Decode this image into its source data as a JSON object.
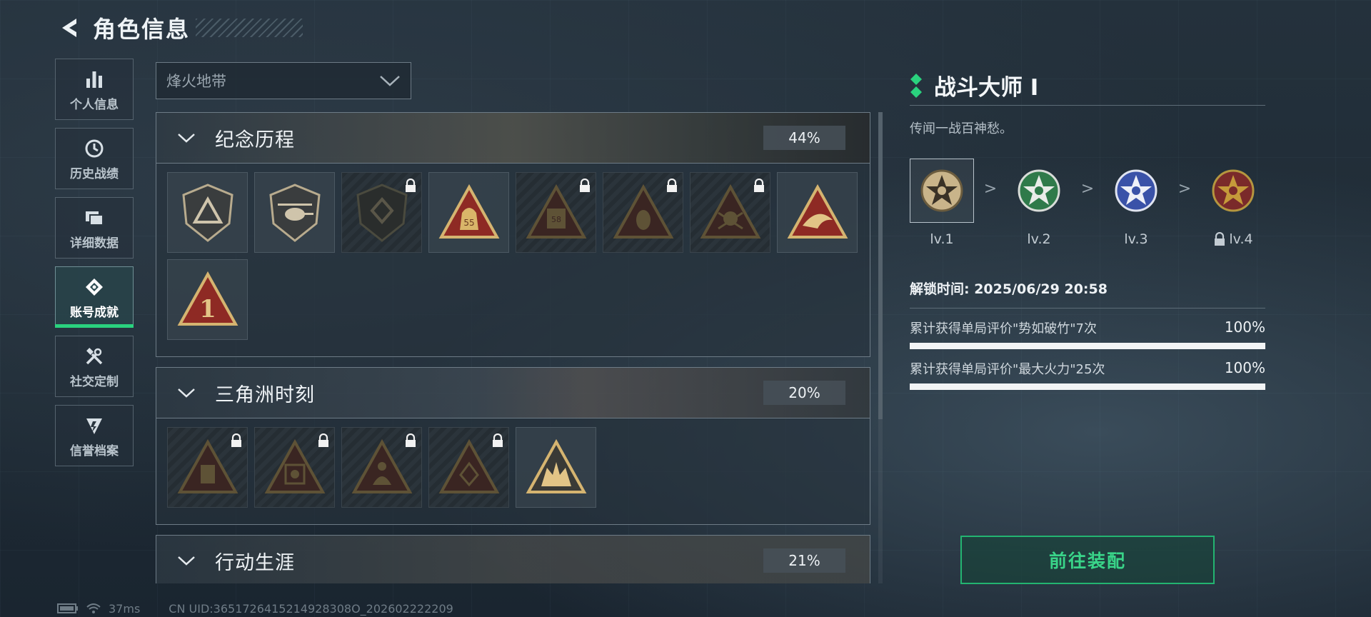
{
  "header": {
    "title": "角色信息"
  },
  "sidebar": {
    "items": [
      {
        "label": "个人信息",
        "icon": "bar-chart-icon"
      },
      {
        "label": "历史战绩",
        "icon": "history-clock-icon"
      },
      {
        "label": "详细数据",
        "icon": "folders-icon"
      },
      {
        "label": "账号成就",
        "icon": "achievement-icon",
        "active": true
      },
      {
        "label": "社交定制",
        "icon": "tools-icon"
      },
      {
        "label": "信誉档案",
        "icon": "reputation-icon"
      }
    ]
  },
  "dropdown": {
    "value": "烽火地带"
  },
  "sections": [
    {
      "name": "纪念历程",
      "percent": "44%",
      "badges_locked": [
        false,
        false,
        true,
        false,
        true,
        true,
        true,
        false,
        false
      ],
      "badge_text": {
        "3": "55",
        "4": "58",
        "8": "1"
      }
    },
    {
      "name": "三角洲时刻",
      "percent": "20%",
      "badges_locked": [
        true,
        true,
        true,
        true,
        false
      ]
    },
    {
      "name": "行动生涯",
      "percent": "21%"
    }
  ],
  "detail": {
    "title": "战斗大师 I",
    "description": "传闻一战百神愁。",
    "levels": [
      {
        "label": "lv.1",
        "color": "#c9b48a",
        "locked": false,
        "selected": true
      },
      {
        "label": "lv.2",
        "color": "#2f7a4a",
        "locked": false
      },
      {
        "label": "lv.3",
        "color": "#3a52a8",
        "locked": false
      },
      {
        "label": "lv.4",
        "color": "#7a2a2a",
        "locked": true
      }
    ],
    "level_separator": ">",
    "unlock_time": "解锁时间: 2025/06/29 20:58",
    "requirements": [
      {
        "text": "累计获得单局评价\"势如破竹\"7次",
        "percent": "100%",
        "progress": 1.0
      },
      {
        "text": "累计获得单局评价\"最大火力\"25次",
        "percent": "100%",
        "progress": 1.0
      }
    ],
    "cta_label": "前往装配"
  },
  "status": {
    "ping": "37ms",
    "uid": "CN UID:3651726415214928308O_202602222209"
  },
  "colors": {
    "accent_green": "#2ad27e",
    "panel_border": "#6d7b86"
  }
}
